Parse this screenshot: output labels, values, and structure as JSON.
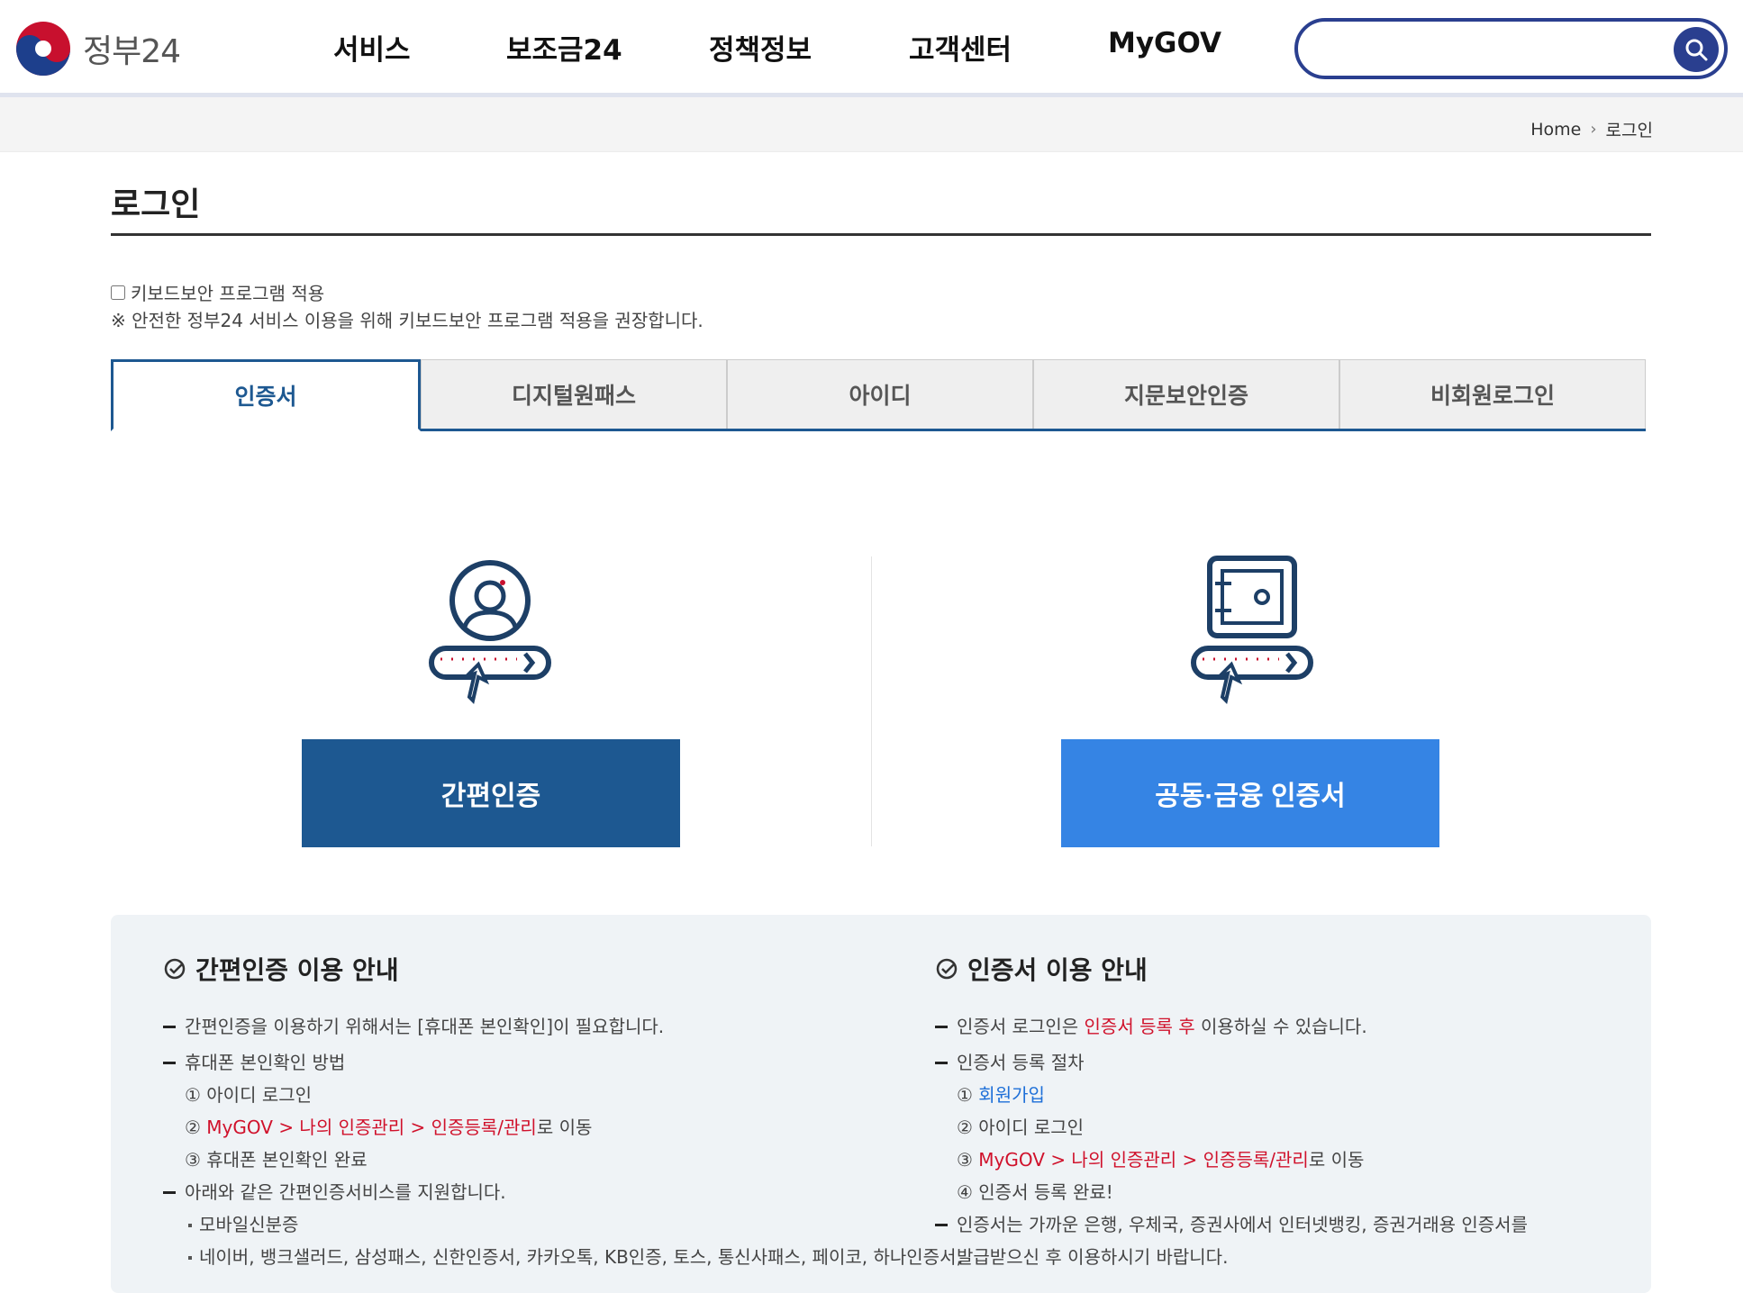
{
  "header": {
    "logo_text": "정부24",
    "nav": [
      "서비스",
      "보조금24",
      "정책정보",
      "고객센터",
      "MyGOV"
    ],
    "search_placeholder": ""
  },
  "breadcrumb": {
    "home": "Home",
    "current": "로그인"
  },
  "page": {
    "title": "로그인",
    "keyboard_security_label": "키보드보안 프로그램 적용",
    "keyboard_security_note": "※ 안전한 정부24 서비스 이용을 위해 키보드보안 프로그램 적용을 권장합니다."
  },
  "tabs": [
    "인증서",
    "디지털원패스",
    "아이디",
    "지문보안인증",
    "비회원로그인"
  ],
  "options": {
    "simple_auth_label": "간편인증",
    "cert_label": "공동·금융 인증서"
  },
  "colors": {
    "primary": "#1d5891",
    "secondary": "#3584e4",
    "accent_red": "#d0112b",
    "nav_blue": "#2a3f8f"
  },
  "info_left": {
    "title": "간편인증 이용 안내",
    "line1": "간편인증을 이용하기 위해서는 [휴대폰 본인확인]이 필요합니다.",
    "line2": "휴대폰 본인확인 방법",
    "step1": "① 아이디 로그인",
    "step2_num": "②",
    "step2_path": "MyGOV > 나의 인증관리 > 인증등록/관리",
    "step2_suffix": "로 이동",
    "step3": "③ 휴대폰 본인확인 완료",
    "line3": "아래와 같은 간편인증서비스를 지원합니다.",
    "bullet1": "모바일신분증",
    "bullet2": "네이버, 뱅크샐러드, 삼성패스, 신한인증서, 카카오톡, KB인증, 토스, 통신사패스, 페이코, 하나인증서,"
  },
  "info_right": {
    "title": "인증서 이용 안내",
    "line1_prefix": "인증서 로그인은 ",
    "line1_highlight": "인증서 등록 후",
    "line1_suffix": " 이용하실 수 있습니다.",
    "line2": "인증서 등록 절차",
    "step1_num": "①",
    "step1_link": "회원가입",
    "step2": "② 아이디 로그인",
    "step3_num": "③",
    "step3_path": "MyGOV > 나의 인증관리 > 인증등록/관리",
    "step3_suffix": "로 이동",
    "step4": "④ 인증서 등록 완료!",
    "line3": "인증서는 가까운 은행, 우체국, 증권사에서 인터넷뱅킹, 증권거래용 인증서를",
    "line4": "발급받으신 후 이용하시기 바랍니다."
  }
}
